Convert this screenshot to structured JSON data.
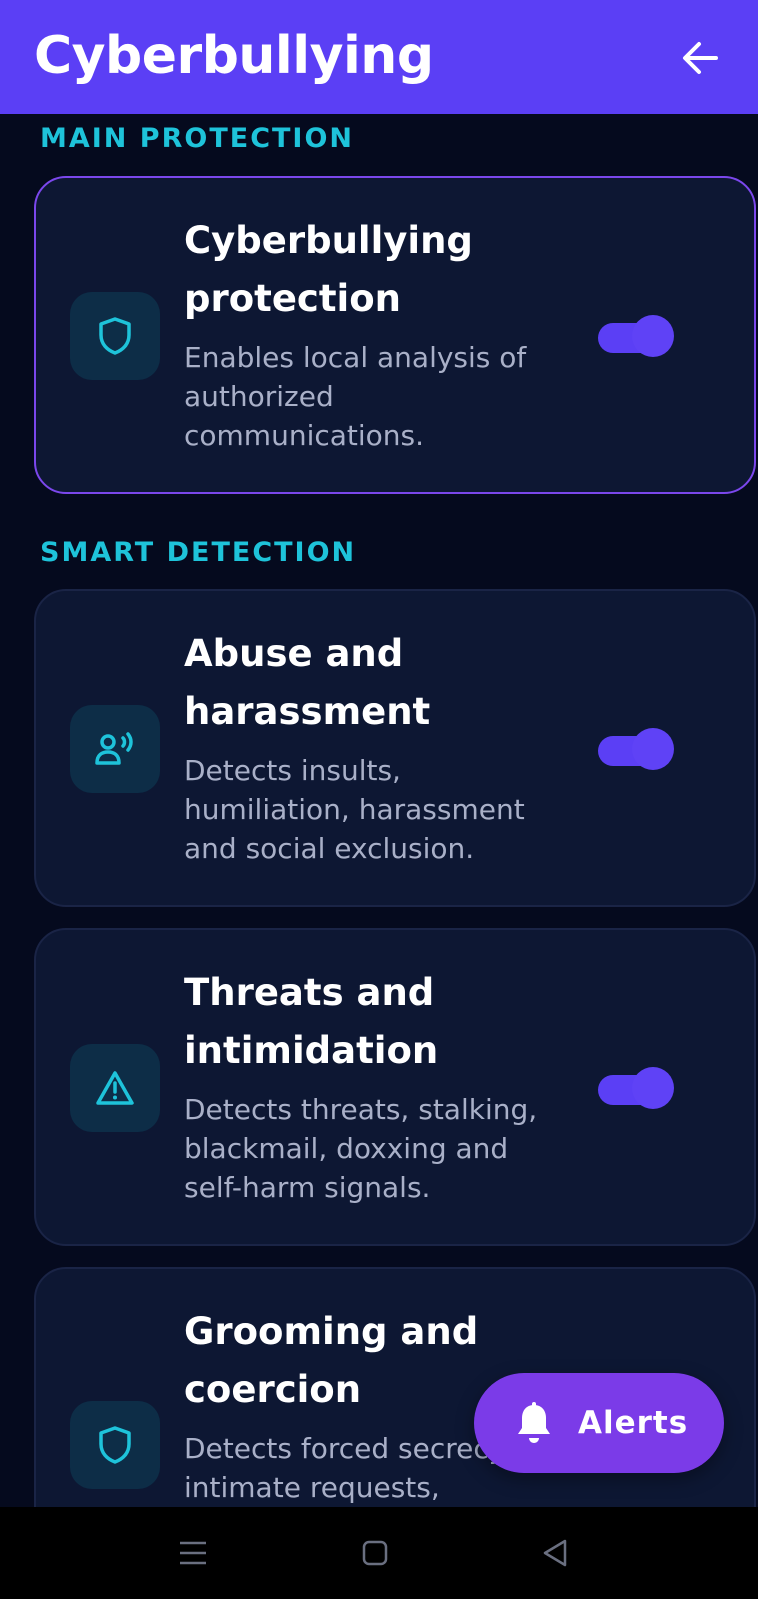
{
  "app_bar": {
    "title": "Cyberbullying",
    "back_icon": "arrow-left-icon"
  },
  "sections": {
    "main": {
      "label": "MAIN PROTECTION"
    },
    "smart": {
      "label": "SMART DETECTION"
    }
  },
  "cards": [
    {
      "title": "Cyberbullying protection",
      "description": "Enables local analysis of authorized communications.",
      "icon": "shield-icon",
      "enabled": true
    },
    {
      "title": "Abuse and harassment",
      "description": "Detects insults, humiliation, harassment and social exclusion.",
      "icon": "person-voice-icon",
      "enabled": true
    },
    {
      "title": "Threats and intimidation",
      "description": "Detects threats, stalking, blackmail, doxxing and self-harm signals.",
      "icon": "warning-icon",
      "enabled": true
    },
    {
      "title": "Grooming and coercion",
      "description": "Detects forced secrecy, intimate requests,",
      "icon": "shield-icon",
      "enabled": true
    }
  ],
  "fab": {
    "label": "Alerts",
    "icon": "bell-icon"
  },
  "system_nav": {
    "menu_icon": "menu-icon",
    "home_icon": "home-icon",
    "back_icon": "triangle-back-icon"
  },
  "colors": {
    "accent": "#5b3ff5",
    "fab": "#7b3be8",
    "section": "#1ec3da",
    "background": "#050a1e",
    "card": "#0d1733"
  }
}
